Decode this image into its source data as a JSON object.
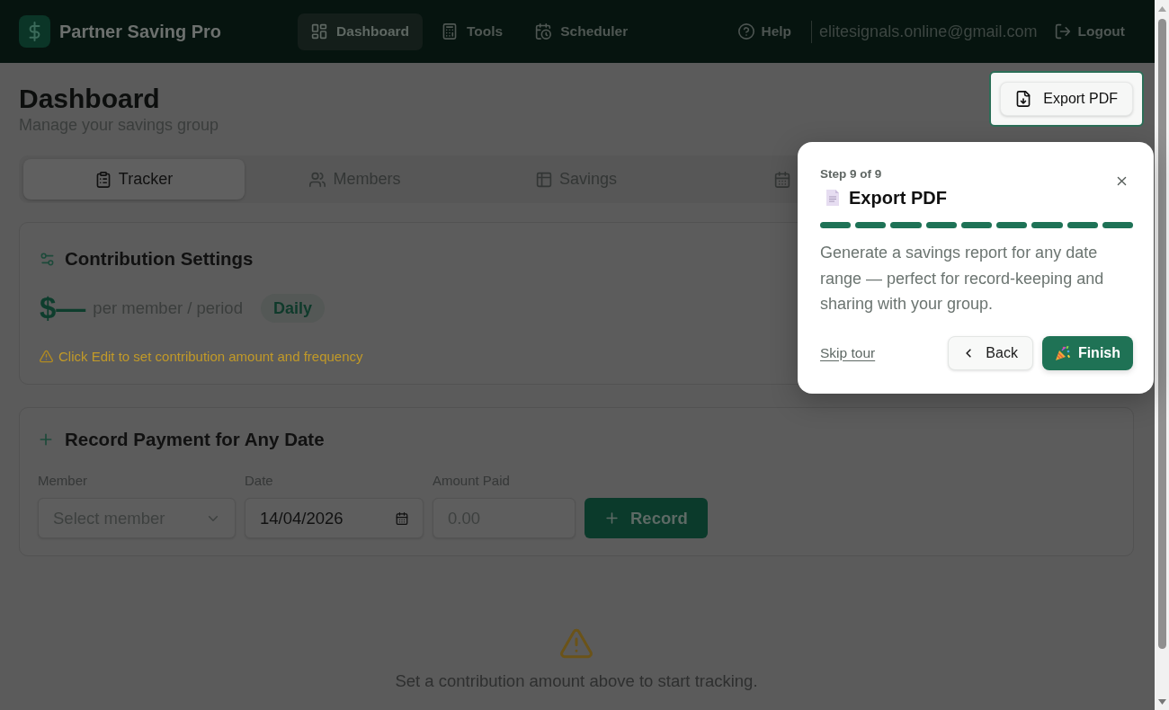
{
  "header": {
    "brand": "Partner Saving Pro",
    "nav": [
      {
        "label": "Dashboard",
        "selected": true
      },
      {
        "label": "Tools",
        "selected": false
      },
      {
        "label": "Scheduler",
        "selected": false
      }
    ],
    "help": "Help",
    "user_email": "elitesignals.online@gmail.com",
    "logout": "Logout"
  },
  "page": {
    "title": "Dashboard",
    "subtitle": "Manage your savings group",
    "export_button": {
      "label": "Export PDF",
      "highlighted": true
    }
  },
  "tabs": [
    {
      "label": "Tracker",
      "selected": true
    },
    {
      "label": "Members",
      "selected": false
    },
    {
      "label": "Savings",
      "selected": false
    },
    {
      "selected": false
    }
  ],
  "contribution_settings": {
    "title": "Contribution Settings",
    "amount": "$—",
    "unit": "per member / period",
    "frequency": "Daily",
    "warning": "Click Edit to set contribution amount and frequency"
  },
  "record_payment": {
    "title": "Record Payment for Any Date",
    "fields": [
      {
        "kind": "select",
        "label": "Member",
        "placeholder": "Select member"
      },
      {
        "kind": "date",
        "label": "Date",
        "value": "14/04/2026"
      },
      {
        "kind": "number",
        "label": "Amount Paid",
        "placeholder": "0.00"
      }
    ],
    "button": "Record"
  },
  "empty_state": {
    "message": "Set a contribution amount above to start tracking."
  },
  "tour": {
    "step": "Step 9 of 9",
    "title": "Export PDF",
    "progress": [
      {
        "done": true
      },
      {
        "done": true
      },
      {
        "done": true
      },
      {
        "done": true
      },
      {
        "done": true
      },
      {
        "done": true
      },
      {
        "done": true
      },
      {
        "done": true
      },
      {
        "done": true
      }
    ],
    "description": "Generate a savings report for any date range — perfect for record-keeping and sharing with your group.",
    "skip": "Skip tour",
    "back": "Back",
    "finish": "Finish"
  }
}
